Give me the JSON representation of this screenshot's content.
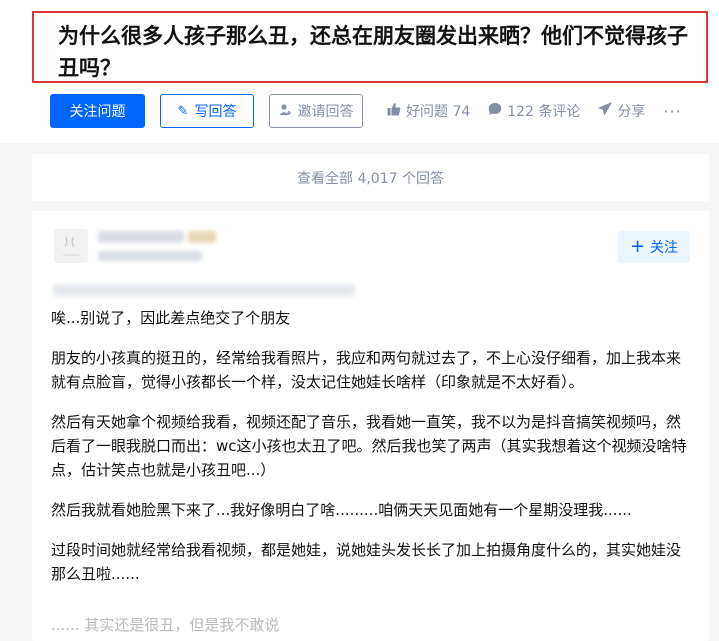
{
  "question": {
    "title": "为什么很多人孩子那么丑，还总在朋友圈发出来晒？他们不觉得孩子丑吗？"
  },
  "actions": {
    "follow_question": "关注问题",
    "write_answer": "写回答",
    "invite_answer": "邀请回答",
    "good_question": "好问题 74",
    "comments": "122 条评论",
    "share": "分享",
    "more": "···"
  },
  "view_all": "查看全部 4,017 个回答",
  "answer": {
    "follow_label": "关注",
    "paragraphs": [
      "唉...别说了，因此差点绝交了个朋友",
      "朋友的小孩真的挺丑的，经常给我看照片，我应和两句就过去了，不上心没仔细看，加上我本来就有点脸盲，觉得小孩都长一个样，没太记住她娃长啥样（印象就是不太好看）。",
      "然后有天她拿个视频给我看，视频还配了音乐，我看她一直笑，我不以为是抖音搞笑视频吗，然后看了一眼我脱口而出：wc这小孩也太丑了吧。然后我也笑了两声（其实我想着这个视频没啥特点，估计笑点也就是小孩丑吧...）",
      "然后我就看她脸黑下来了...我好像明白了啥.........咱俩天天见面她有一个星期没理我......",
      "过段时间她就经常给我看视频，都是她娃，说她娃头发长长了加上拍摄角度什么的，其实她娃没那么丑啦......"
    ],
    "cut_line": "...... 其实还是很丑，但是我不敢说"
  }
}
